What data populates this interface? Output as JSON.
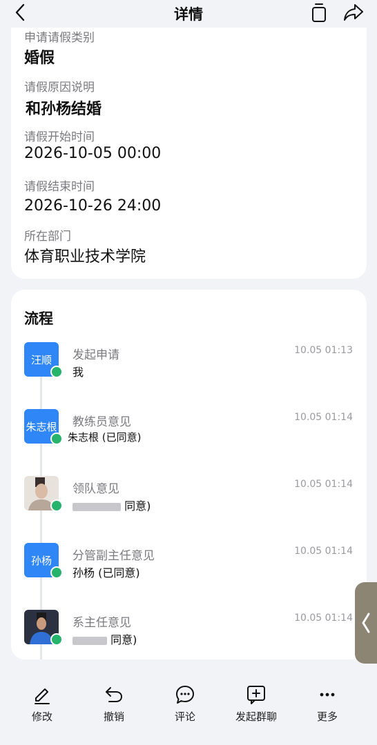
{
  "header": {
    "title": "详情"
  },
  "detail": {
    "fields": [
      {
        "label": "申请请假类别",
        "value": "婚假"
      },
      {
        "label": "请假原因说明",
        "value": "和孙杨结婚"
      },
      {
        "label": "请假开始时间",
        "value": "2026-10-05 00:00"
      },
      {
        "label": "请假结束时间",
        "value": "2026-10-26 24:00"
      },
      {
        "label": "所在部门",
        "value": "体育职业技术学院"
      }
    ]
  },
  "flow": {
    "title": "流程",
    "steps": [
      {
        "avatar": "汪顺",
        "name": "发起申请",
        "person": "我",
        "time": "10.05 01:13"
      },
      {
        "avatar": "朱志根",
        "name": "教练员意见",
        "person": "朱志根 (已同意)",
        "time": "10.05 01:14"
      },
      {
        "avatar": "",
        "name": "领队意见",
        "person": "同意)",
        "time": "10.05 01:14"
      },
      {
        "avatar": "孙杨",
        "name": "分管副主任意见",
        "person": "孙杨 (已同意)",
        "time": "10.05 01:14"
      },
      {
        "avatar": "",
        "name": "系主任意见",
        "person": "同意)",
        "time": "10.05 01:14"
      }
    ]
  },
  "toolbar": {
    "items": [
      {
        "label": "修改",
        "icon": "edit-icon"
      },
      {
        "label": "撤销",
        "icon": "undo-icon"
      },
      {
        "label": "评论",
        "icon": "comment-icon"
      },
      {
        "label": "发起群聊",
        "icon": "group-chat-icon"
      },
      {
        "label": "更多",
        "icon": "more-icon"
      }
    ]
  },
  "colors": {
    "accent": "#2f86f6",
    "success": "#26b36b",
    "background": "#f2f3f7"
  }
}
